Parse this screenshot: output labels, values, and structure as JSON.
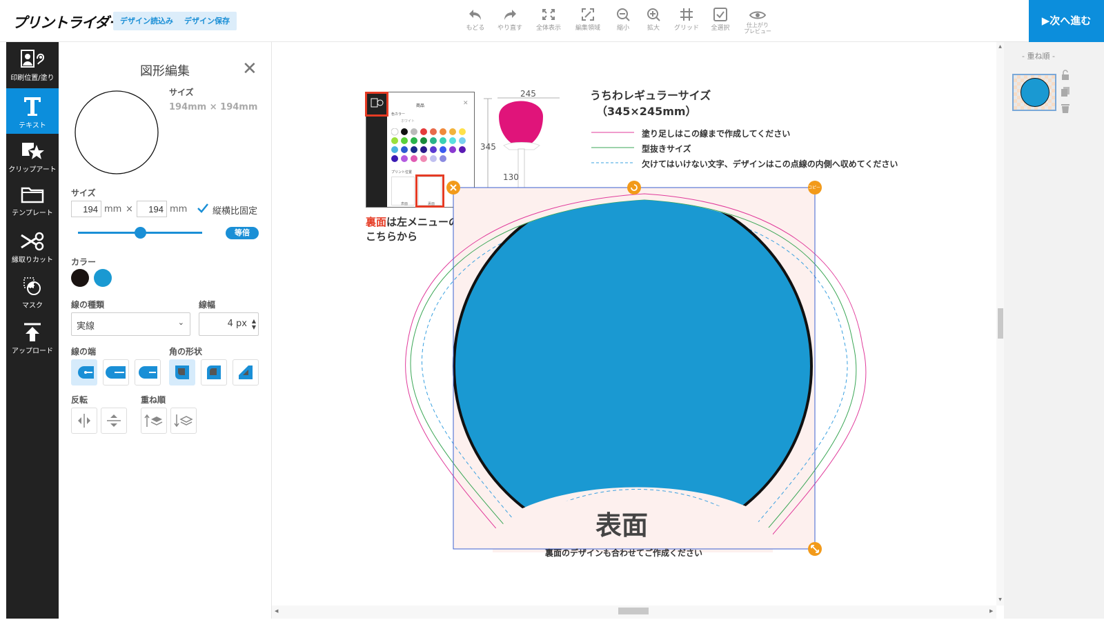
{
  "app": {
    "logo": "プリントライダー"
  },
  "header": {
    "load_label": "デザイン読込み",
    "save_label": "デザイン保存",
    "next_label": "▶次へ進む",
    "tools": [
      {
        "label": "もどる",
        "icon": "undo-icon"
      },
      {
        "label": "やり直す",
        "icon": "redo-icon"
      },
      {
        "label": "全体表示",
        "icon": "fit-icon"
      },
      {
        "label": "編集領域",
        "icon": "edit-area-icon"
      },
      {
        "label": "縮小",
        "icon": "zoom-out-icon"
      },
      {
        "label": "拡大",
        "icon": "zoom-in-icon"
      },
      {
        "label": "グリッド",
        "icon": "grid-icon"
      },
      {
        "label": "全選択",
        "icon": "select-all-icon"
      },
      {
        "label": "仕上がり",
        "label2": "プレビュー",
        "icon": "eye-icon"
      }
    ]
  },
  "sidebar": {
    "items": [
      {
        "label": "印刷位置/塗り",
        "icon": "print-position-icon"
      },
      {
        "label": "テキスト",
        "icon": "text-icon"
      },
      {
        "label": "クリップアート",
        "icon": "clipart-icon"
      },
      {
        "label": "テンプレート",
        "icon": "template-icon"
      },
      {
        "label": "縁取りカット",
        "icon": "scissors-icon"
      },
      {
        "label": "マスク",
        "icon": "mask-icon"
      },
      {
        "label": "アップロード",
        "icon": "upload-icon"
      }
    ],
    "active_index": 1
  },
  "panel": {
    "title": "図形編集",
    "size_label": "サイズ",
    "size_value": "194mm × 194mm",
    "size_section_label": "サイズ",
    "width_value": "194",
    "height_value": "194",
    "unit": "mm",
    "times": "×",
    "aspect_lock_label": "縦横比固定",
    "aspect_lock_checked": true,
    "scale_button": "等倍",
    "slider_value_fraction": 0.5,
    "color_label": "カラー",
    "colors": [
      "#1a1311",
      "#1a99d2"
    ],
    "line_type_label": "線の種類",
    "line_type_value": "実線",
    "line_width_label": "線幅",
    "line_width_value": "4",
    "line_width_unit": "px",
    "line_end_label": "線の端",
    "corner_label": "角の形状",
    "flip_label": "反転",
    "order_label": "重ね順"
  },
  "canvas": {
    "product_title": "うちわレギュラーサイズ",
    "product_size": "（345×245mm）",
    "dim_width": "245",
    "dim_height": "345",
    "dim_handle": "130",
    "legend": [
      {
        "text": "塗り足しはこの線まで作成してください",
        "color": "#e0399a"
      },
      {
        "text": "型抜きサイズ",
        "color": "#3aa655"
      },
      {
        "text": "欠けてはいけない文字、デザインはこの点線の内側へ収めてください",
        "color": "#39a0e0"
      }
    ],
    "hint_red": "裏面",
    "hint_rest": "は左メニューの",
    "hint_line2": "こちらから",
    "front_label": "表面",
    "back_note": "裏面のデザインも合わせてご作成ください",
    "copy_handle": "コピー",
    "mini_panel": {
      "title": "商品",
      "color_label": "色カラー",
      "white_label": "ホワイト",
      "print_label": "プリント位置",
      "front": "表面",
      "back": "裏面"
    }
  },
  "layers": {
    "title": "- 重ね順 -",
    "shape_color": "#1a99d2"
  }
}
